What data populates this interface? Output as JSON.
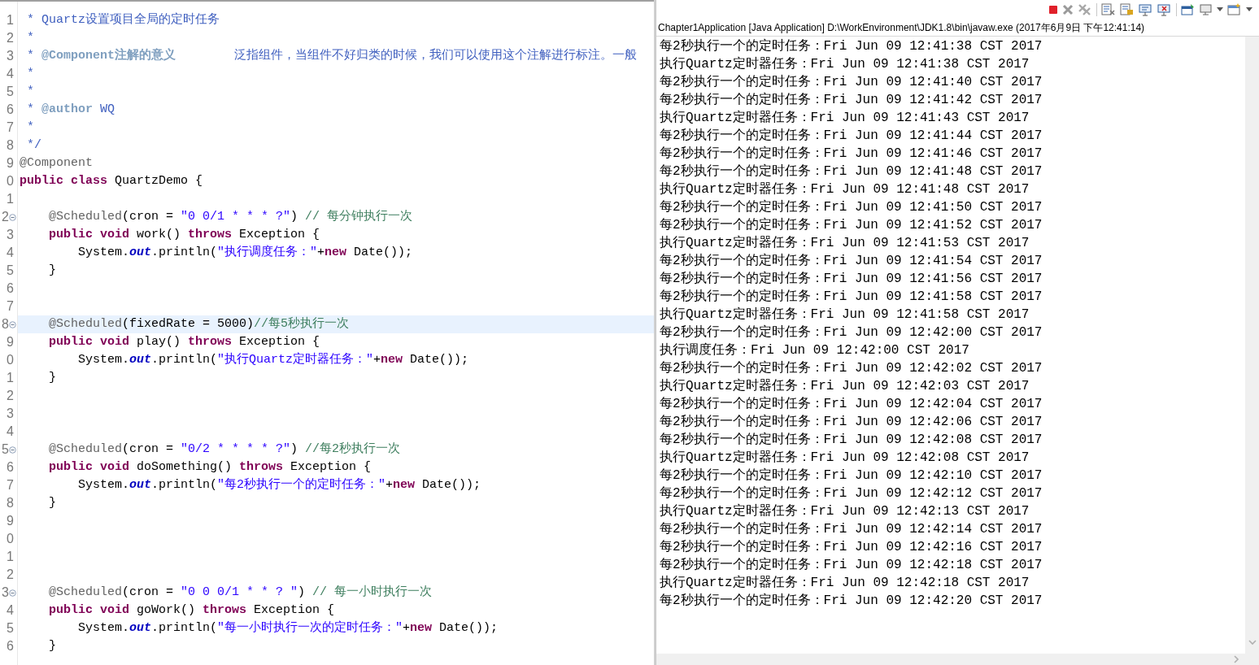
{
  "editor": {
    "lines": [
      {
        "number": "1",
        "tokens": [
          {
            "kind": "javadoc",
            "text": " * Quartz设置项目全局的定时任务"
          }
        ]
      },
      {
        "number": "2",
        "tokens": [
          {
            "kind": "javadoc",
            "text": " *"
          }
        ]
      },
      {
        "number": "3",
        "tokens": [
          {
            "kind": "javadoc",
            "text": " * "
          },
          {
            "kind": "javadoc_tag",
            "text": "@Component注解的意义"
          },
          {
            "kind": "javadoc",
            "text": "        泛指组件，当组件不好归类的时候，我们可以使用这个注解进行标注。一般"
          }
        ]
      },
      {
        "number": "4",
        "tokens": [
          {
            "kind": "javadoc",
            "text": " *"
          }
        ]
      },
      {
        "number": "5",
        "tokens": [
          {
            "kind": "javadoc",
            "text": " *"
          }
        ]
      },
      {
        "number": "6",
        "tokens": [
          {
            "kind": "javadoc",
            "text": " * "
          },
          {
            "kind": "javadoc_tag",
            "text": "@author"
          },
          {
            "kind": "javadoc",
            "text": " WQ"
          }
        ]
      },
      {
        "number": "7",
        "tokens": [
          {
            "kind": "javadoc",
            "text": " *"
          }
        ]
      },
      {
        "number": "8",
        "tokens": [
          {
            "kind": "javadoc",
            "text": " */"
          }
        ]
      },
      {
        "number": "9",
        "tokens": [
          {
            "kind": "annotation",
            "text": "@Component"
          }
        ]
      },
      {
        "number": "0",
        "tokens": [
          {
            "kind": "keyword",
            "text": "public class"
          },
          {
            "kind": "plain",
            "text": " QuartzDemo {"
          }
        ]
      },
      {
        "number": "1"
      },
      {
        "number": "2",
        "fold": true,
        "tokens": [
          {
            "kind": "annotation",
            "text": "    @Scheduled"
          },
          {
            "kind": "plain",
            "text": "(cron = "
          },
          {
            "kind": "string",
            "text": "\"0 0/1 * * * ?\""
          },
          {
            "kind": "plain",
            "text": ") "
          },
          {
            "kind": "comment",
            "text": "// 每分钟执行一次"
          }
        ]
      },
      {
        "number": "3",
        "tokens": [
          {
            "kind": "keyword",
            "text": "    public void"
          },
          {
            "kind": "plain",
            "text": " work() "
          },
          {
            "kind": "keyword",
            "text": "throws"
          },
          {
            "kind": "plain",
            "text": " Exception {"
          }
        ]
      },
      {
        "number": "4",
        "tokens": [
          {
            "kind": "plain",
            "text": "        System."
          },
          {
            "kind": "field",
            "text": "out"
          },
          {
            "kind": "plain",
            "text": ".println("
          },
          {
            "kind": "string",
            "text": "\"执行调度任务：\""
          },
          {
            "kind": "plain",
            "text": "+"
          },
          {
            "kind": "keyword",
            "text": "new"
          },
          {
            "kind": "plain",
            "text": " Date());"
          }
        ]
      },
      {
        "number": "5",
        "tokens": [
          {
            "kind": "plain",
            "text": "    }"
          }
        ]
      },
      {
        "number": "6"
      },
      {
        "number": "7"
      },
      {
        "number": "8",
        "fold": true,
        "highlighted": true,
        "tokens": [
          {
            "kind": "annotation",
            "text": "    @Scheduled"
          },
          {
            "kind": "plain",
            "text": "(fixedRate = 5000)"
          },
          {
            "kind": "comment",
            "text": "//每5秒执行一次"
          }
        ]
      },
      {
        "number": "9",
        "tokens": [
          {
            "kind": "keyword",
            "text": "    public void"
          },
          {
            "kind": "plain",
            "text": " play() "
          },
          {
            "kind": "keyword",
            "text": "throws"
          },
          {
            "kind": "plain",
            "text": " Exception {"
          }
        ]
      },
      {
        "number": "0",
        "tokens": [
          {
            "kind": "plain",
            "text": "        System."
          },
          {
            "kind": "field",
            "text": "out"
          },
          {
            "kind": "plain",
            "text": ".println("
          },
          {
            "kind": "string",
            "text": "\"执行Quartz定时器任务：\""
          },
          {
            "kind": "plain",
            "text": "+"
          },
          {
            "kind": "keyword",
            "text": "new"
          },
          {
            "kind": "plain",
            "text": " Date());"
          }
        ]
      },
      {
        "number": "1",
        "tokens": [
          {
            "kind": "plain",
            "text": "    }"
          }
        ]
      },
      {
        "number": "2"
      },
      {
        "number": "3"
      },
      {
        "number": "4"
      },
      {
        "number": "5",
        "fold": true,
        "tokens": [
          {
            "kind": "annotation",
            "text": "    @Scheduled"
          },
          {
            "kind": "plain",
            "text": "(cron = "
          },
          {
            "kind": "string",
            "text": "\"0/2 * * * * ?\""
          },
          {
            "kind": "plain",
            "text": ") "
          },
          {
            "kind": "comment",
            "text": "//每2秒执行一次"
          }
        ]
      },
      {
        "number": "6",
        "tokens": [
          {
            "kind": "keyword",
            "text": "    public void"
          },
          {
            "kind": "plain",
            "text": " doSomething() "
          },
          {
            "kind": "keyword",
            "text": "throws"
          },
          {
            "kind": "plain",
            "text": " Exception {"
          }
        ]
      },
      {
        "number": "7",
        "tokens": [
          {
            "kind": "plain",
            "text": "        System."
          },
          {
            "kind": "field",
            "text": "out"
          },
          {
            "kind": "plain",
            "text": ".println("
          },
          {
            "kind": "string",
            "text": "\"每2秒执行一个的定时任务：\""
          },
          {
            "kind": "plain",
            "text": "+"
          },
          {
            "kind": "keyword",
            "text": "new"
          },
          {
            "kind": "plain",
            "text": " Date());"
          }
        ]
      },
      {
        "number": "8",
        "tokens": [
          {
            "kind": "plain",
            "text": "    }"
          }
        ]
      },
      {
        "number": "9"
      },
      {
        "number": "0"
      },
      {
        "number": "1"
      },
      {
        "number": "2"
      },
      {
        "number": "3",
        "fold": true,
        "tokens": [
          {
            "kind": "annotation",
            "text": "    @Scheduled"
          },
          {
            "kind": "plain",
            "text": "(cron = "
          },
          {
            "kind": "string",
            "text": "\"0 0 0/1 * * ? \""
          },
          {
            "kind": "plain",
            "text": ") "
          },
          {
            "kind": "comment",
            "text": "// 每一小时执行一次"
          }
        ]
      },
      {
        "number": "4",
        "tokens": [
          {
            "kind": "keyword",
            "text": "    public void"
          },
          {
            "kind": "plain",
            "text": " goWork() "
          },
          {
            "kind": "keyword",
            "text": "throws"
          },
          {
            "kind": "plain",
            "text": " Exception {"
          }
        ]
      },
      {
        "number": "5",
        "tokens": [
          {
            "kind": "plain",
            "text": "        System."
          },
          {
            "kind": "field",
            "text": "out"
          },
          {
            "kind": "plain",
            "text": ".println("
          },
          {
            "kind": "string",
            "text": "\"每一小时执行一次的定时任务：\""
          },
          {
            "kind": "plain",
            "text": "+"
          },
          {
            "kind": "keyword",
            "text": "new"
          },
          {
            "kind": "plain",
            "text": " Date());"
          }
        ]
      },
      {
        "number": "6",
        "tokens": [
          {
            "kind": "plain",
            "text": "    }"
          }
        ]
      }
    ]
  },
  "console": {
    "title": "Chapter1Application [Java Application] D:\\WorkEnvironment\\JDK1.8\\bin\\javaw.exe (2017年6月9日 下午12:41:14)",
    "output": [
      "每2秒执行一个的定时任务：Fri Jun 09 12:41:38 CST 2017",
      "执行Quartz定时器任务：Fri Jun 09 12:41:38 CST 2017",
      "每2秒执行一个的定时任务：Fri Jun 09 12:41:40 CST 2017",
      "每2秒执行一个的定时任务：Fri Jun 09 12:41:42 CST 2017",
      "执行Quartz定时器任务：Fri Jun 09 12:41:43 CST 2017",
      "每2秒执行一个的定时任务：Fri Jun 09 12:41:44 CST 2017",
      "每2秒执行一个的定时任务：Fri Jun 09 12:41:46 CST 2017",
      "每2秒执行一个的定时任务：Fri Jun 09 12:41:48 CST 2017",
      "执行Quartz定时器任务：Fri Jun 09 12:41:48 CST 2017",
      "每2秒执行一个的定时任务：Fri Jun 09 12:41:50 CST 2017",
      "每2秒执行一个的定时任务：Fri Jun 09 12:41:52 CST 2017",
      "执行Quartz定时器任务：Fri Jun 09 12:41:53 CST 2017",
      "每2秒执行一个的定时任务：Fri Jun 09 12:41:54 CST 2017",
      "每2秒执行一个的定时任务：Fri Jun 09 12:41:56 CST 2017",
      "每2秒执行一个的定时任务：Fri Jun 09 12:41:58 CST 2017",
      "执行Quartz定时器任务：Fri Jun 09 12:41:58 CST 2017",
      "每2秒执行一个的定时任务：Fri Jun 09 12:42:00 CST 2017",
      "执行调度任务：Fri Jun 09 12:42:00 CST 2017",
      "每2秒执行一个的定时任务：Fri Jun 09 12:42:02 CST 2017",
      "执行Quartz定时器任务：Fri Jun 09 12:42:03 CST 2017",
      "每2秒执行一个的定时任务：Fri Jun 09 12:42:04 CST 2017",
      "每2秒执行一个的定时任务：Fri Jun 09 12:42:06 CST 2017",
      "每2秒执行一个的定时任务：Fri Jun 09 12:42:08 CST 2017",
      "执行Quartz定时器任务：Fri Jun 09 12:42:08 CST 2017",
      "每2秒执行一个的定时任务：Fri Jun 09 12:42:10 CST 2017",
      "每2秒执行一个的定时任务：Fri Jun 09 12:42:12 CST 2017",
      "执行Quartz定时器任务：Fri Jun 09 12:42:13 CST 2017",
      "每2秒执行一个的定时任务：Fri Jun 09 12:42:14 CST 2017",
      "每2秒执行一个的定时任务：Fri Jun 09 12:42:16 CST 2017",
      "每2秒执行一个的定时任务：Fri Jun 09 12:42:18 CST 2017",
      "执行Quartz定时器任务：Fri Jun 09 12:42:18 CST 2017",
      "每2秒执行一个的定时任务：Fri Jun 09 12:42:20 CST 2017"
    ]
  }
}
